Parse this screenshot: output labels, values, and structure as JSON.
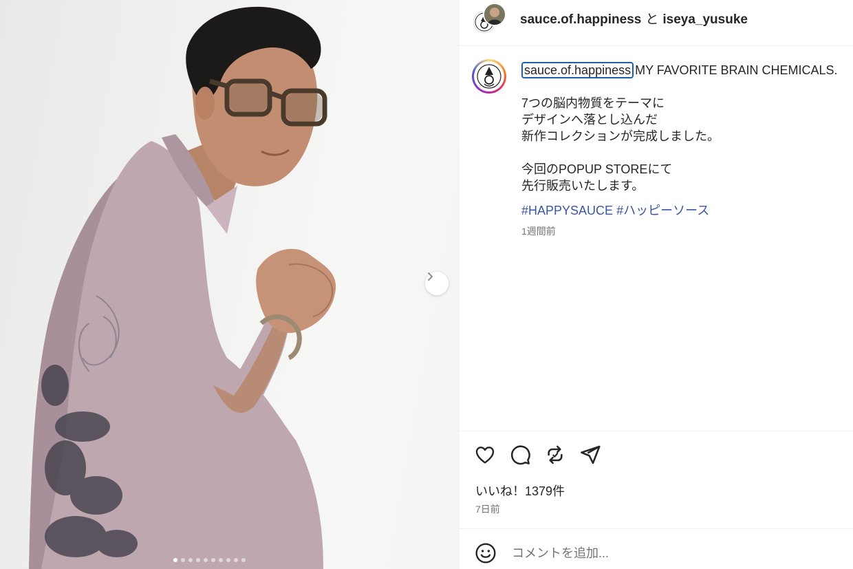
{
  "post": {
    "carousel": {
      "slide_count": 10,
      "active_index": 0
    }
  },
  "header": {
    "account1": "sauce.of.happiness",
    "conjunction": "と",
    "account2": "iseya_yusuke"
  },
  "caption": {
    "username": "sauce.of.happiness",
    "title": "MY FAVORITE BRAIN CHEMICALS.",
    "line1": "7つの脳内物質をテーマに",
    "line2": "デザインへ落とし込んだ",
    "line3": "新作コレクションが完成しました。",
    "line4": "今回のPOPUP STOREにて",
    "line5": "先行販売いたします。",
    "hashtag1": "#HAPPYSAUCE",
    "hashtag2": "#ハッピーソース",
    "time_ago": "1週間前"
  },
  "actions": {
    "like_icon": "heart-icon",
    "comment_icon": "comment-icon",
    "repost_icon": "repost-icon",
    "share_icon": "send-icon"
  },
  "stats": {
    "likes": "いいね！1379件",
    "date": "7日前"
  },
  "comment": {
    "placeholder": "コメントを追加..."
  }
}
